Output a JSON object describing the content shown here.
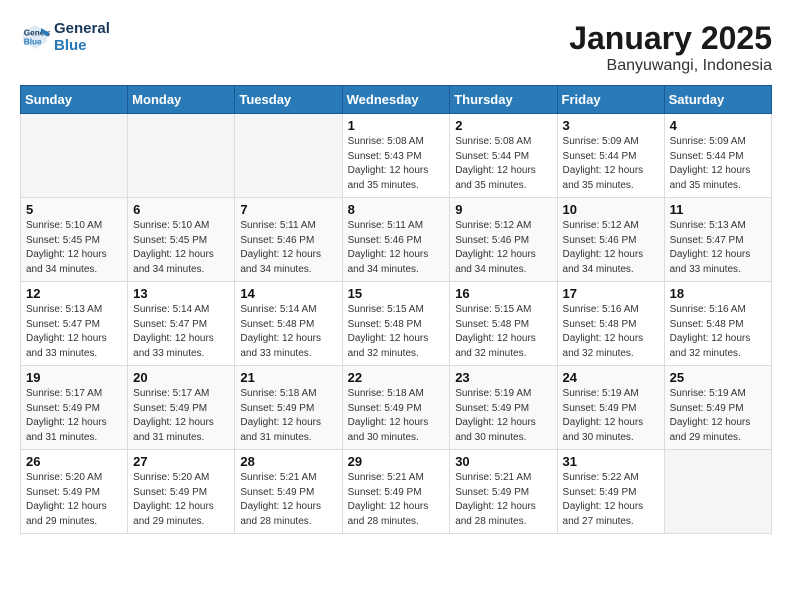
{
  "header": {
    "logo_line1": "General",
    "logo_line2": "Blue",
    "month": "January 2025",
    "location": "Banyuwangi, Indonesia"
  },
  "days_of_week": [
    "Sunday",
    "Monday",
    "Tuesday",
    "Wednesday",
    "Thursday",
    "Friday",
    "Saturday"
  ],
  "weeks": [
    [
      {
        "day": "",
        "info": ""
      },
      {
        "day": "",
        "info": ""
      },
      {
        "day": "",
        "info": ""
      },
      {
        "day": "1",
        "info": "Sunrise: 5:08 AM\nSunset: 5:43 PM\nDaylight: 12 hours\nand 35 minutes."
      },
      {
        "day": "2",
        "info": "Sunrise: 5:08 AM\nSunset: 5:44 PM\nDaylight: 12 hours\nand 35 minutes."
      },
      {
        "day": "3",
        "info": "Sunrise: 5:09 AM\nSunset: 5:44 PM\nDaylight: 12 hours\nand 35 minutes."
      },
      {
        "day": "4",
        "info": "Sunrise: 5:09 AM\nSunset: 5:44 PM\nDaylight: 12 hours\nand 35 minutes."
      }
    ],
    [
      {
        "day": "5",
        "info": "Sunrise: 5:10 AM\nSunset: 5:45 PM\nDaylight: 12 hours\nand 34 minutes."
      },
      {
        "day": "6",
        "info": "Sunrise: 5:10 AM\nSunset: 5:45 PM\nDaylight: 12 hours\nand 34 minutes."
      },
      {
        "day": "7",
        "info": "Sunrise: 5:11 AM\nSunset: 5:46 PM\nDaylight: 12 hours\nand 34 minutes."
      },
      {
        "day": "8",
        "info": "Sunrise: 5:11 AM\nSunset: 5:46 PM\nDaylight: 12 hours\nand 34 minutes."
      },
      {
        "day": "9",
        "info": "Sunrise: 5:12 AM\nSunset: 5:46 PM\nDaylight: 12 hours\nand 34 minutes."
      },
      {
        "day": "10",
        "info": "Sunrise: 5:12 AM\nSunset: 5:46 PM\nDaylight: 12 hours\nand 34 minutes."
      },
      {
        "day": "11",
        "info": "Sunrise: 5:13 AM\nSunset: 5:47 PM\nDaylight: 12 hours\nand 33 minutes."
      }
    ],
    [
      {
        "day": "12",
        "info": "Sunrise: 5:13 AM\nSunset: 5:47 PM\nDaylight: 12 hours\nand 33 minutes."
      },
      {
        "day": "13",
        "info": "Sunrise: 5:14 AM\nSunset: 5:47 PM\nDaylight: 12 hours\nand 33 minutes."
      },
      {
        "day": "14",
        "info": "Sunrise: 5:14 AM\nSunset: 5:48 PM\nDaylight: 12 hours\nand 33 minutes."
      },
      {
        "day": "15",
        "info": "Sunrise: 5:15 AM\nSunset: 5:48 PM\nDaylight: 12 hours\nand 32 minutes."
      },
      {
        "day": "16",
        "info": "Sunrise: 5:15 AM\nSunset: 5:48 PM\nDaylight: 12 hours\nand 32 minutes."
      },
      {
        "day": "17",
        "info": "Sunrise: 5:16 AM\nSunset: 5:48 PM\nDaylight: 12 hours\nand 32 minutes."
      },
      {
        "day": "18",
        "info": "Sunrise: 5:16 AM\nSunset: 5:48 PM\nDaylight: 12 hours\nand 32 minutes."
      }
    ],
    [
      {
        "day": "19",
        "info": "Sunrise: 5:17 AM\nSunset: 5:49 PM\nDaylight: 12 hours\nand 31 minutes."
      },
      {
        "day": "20",
        "info": "Sunrise: 5:17 AM\nSunset: 5:49 PM\nDaylight: 12 hours\nand 31 minutes."
      },
      {
        "day": "21",
        "info": "Sunrise: 5:18 AM\nSunset: 5:49 PM\nDaylight: 12 hours\nand 31 minutes."
      },
      {
        "day": "22",
        "info": "Sunrise: 5:18 AM\nSunset: 5:49 PM\nDaylight: 12 hours\nand 30 minutes."
      },
      {
        "day": "23",
        "info": "Sunrise: 5:19 AM\nSunset: 5:49 PM\nDaylight: 12 hours\nand 30 minutes."
      },
      {
        "day": "24",
        "info": "Sunrise: 5:19 AM\nSunset: 5:49 PM\nDaylight: 12 hours\nand 30 minutes."
      },
      {
        "day": "25",
        "info": "Sunrise: 5:19 AM\nSunset: 5:49 PM\nDaylight: 12 hours\nand 29 minutes."
      }
    ],
    [
      {
        "day": "26",
        "info": "Sunrise: 5:20 AM\nSunset: 5:49 PM\nDaylight: 12 hours\nand 29 minutes."
      },
      {
        "day": "27",
        "info": "Sunrise: 5:20 AM\nSunset: 5:49 PM\nDaylight: 12 hours\nand 29 minutes."
      },
      {
        "day": "28",
        "info": "Sunrise: 5:21 AM\nSunset: 5:49 PM\nDaylight: 12 hours\nand 28 minutes."
      },
      {
        "day": "29",
        "info": "Sunrise: 5:21 AM\nSunset: 5:49 PM\nDaylight: 12 hours\nand 28 minutes."
      },
      {
        "day": "30",
        "info": "Sunrise: 5:21 AM\nSunset: 5:49 PM\nDaylight: 12 hours\nand 28 minutes."
      },
      {
        "day": "31",
        "info": "Sunrise: 5:22 AM\nSunset: 5:49 PM\nDaylight: 12 hours\nand 27 minutes."
      },
      {
        "day": "",
        "info": ""
      }
    ]
  ]
}
